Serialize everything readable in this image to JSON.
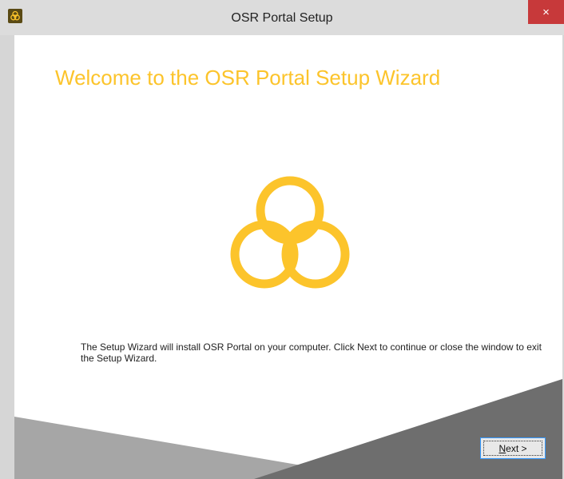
{
  "window": {
    "title": "OSR Portal Setup",
    "close_label": "×"
  },
  "wizard": {
    "heading": "Welcome to the OSR Portal Setup Wizard",
    "description": "The Setup Wizard will install OSR Portal on your computer. Click Next to continue or close the window to exit the Setup Wizard.",
    "next_button": {
      "mnemonic": "N",
      "rest": "ext >"
    }
  },
  "colors": {
    "accent": "#fcc42b",
    "close": "#c7393a"
  },
  "icons": {
    "app": "osr-logo-icon",
    "logo": "osr-trefoil-logo-icon"
  }
}
